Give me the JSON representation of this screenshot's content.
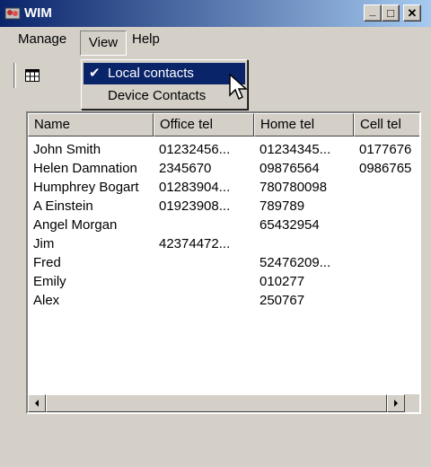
{
  "window": {
    "title": "WIM",
    "min_label": "_",
    "max_label": "□",
    "close_label": "✕"
  },
  "menubar": {
    "manage": "Manage",
    "view": "View",
    "help": "Help"
  },
  "view_menu": {
    "items": [
      {
        "label": "Local contacts",
        "checked": true,
        "check": "✔"
      },
      {
        "label": "Device Contacts",
        "checked": false
      }
    ]
  },
  "toolbar": {
    "grid_icon": "grid-view-icon"
  },
  "contacts": {
    "columns": [
      "Name",
      "Office tel",
      "Home tel",
      "Cell tel"
    ],
    "rows": [
      [
        "John Smith",
        "01232456...",
        "01234345...",
        "0177676"
      ],
      [
        "Helen Damnation",
        "2345670",
        "09876564",
        "0986765"
      ],
      [
        "Humphrey Bogart",
        "01283904...",
        "780780098",
        ""
      ],
      [
        "A Einstein",
        "01923908...",
        "789789",
        ""
      ],
      [
        "Angel Morgan",
        "",
        "65432954",
        ""
      ],
      [
        "Jim",
        "42374472...",
        "",
        ""
      ],
      [
        "Fred",
        "",
        "52476209...",
        ""
      ],
      [
        "Emily",
        "",
        "010277",
        ""
      ],
      [
        "Alex",
        "",
        "250767",
        ""
      ]
    ]
  },
  "colors": {
    "titlebar_start": "#0a246a",
    "titlebar_end": "#a6caf0",
    "face": "#d4d0c8",
    "highlight": "#0a246a"
  }
}
